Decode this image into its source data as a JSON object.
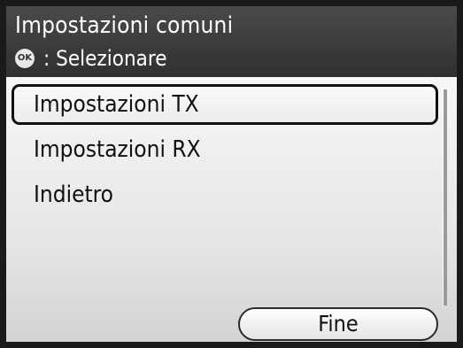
{
  "header": {
    "title": "Impostazioni comuni",
    "subtitle": ": Selezionare",
    "ok_icon_label": "OK",
    "ok_icon_name": "ok-button-icon"
  },
  "menu": {
    "items": [
      {
        "label": "Impostazioni TX",
        "selected": true
      },
      {
        "label": "Impostazioni RX",
        "selected": false
      },
      {
        "label": "Indietro",
        "selected": false
      }
    ]
  },
  "footer": {
    "fine_label": "Fine"
  },
  "colors": {
    "header_bg": "#3a3a3a",
    "frame_border": "#1a1a1a",
    "list_bg": "#f0f0f0"
  }
}
